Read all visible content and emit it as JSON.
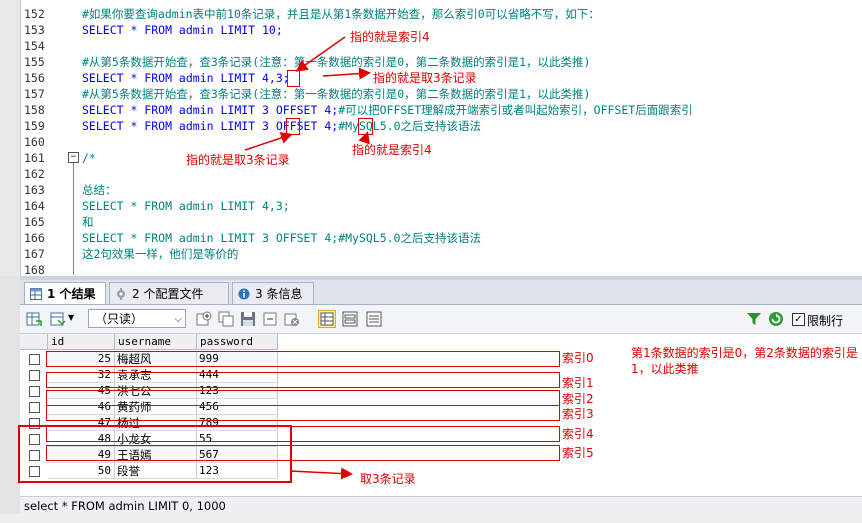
{
  "editor": {
    "lines": [
      {
        "num": "152",
        "parts": [
          {
            "c": "c-comment",
            "t": "#如果你要查询admin表中前10条记录，并且是从第1条数据开始查，那么索引0可以省略不写，如下："
          }
        ]
      },
      {
        "num": "153",
        "parts": [
          {
            "c": "c-plain",
            "t": "SELECT * FROM admin LIMIT 10;"
          }
        ]
      },
      {
        "num": "154",
        "parts": []
      },
      {
        "num": "155",
        "parts": [
          {
            "c": "c-comment",
            "t": "#从第5条数据开始查，查3条记录(注意：第一条数据的索引是0，第二条数据的索引是1，以此类推)"
          }
        ]
      },
      {
        "num": "156",
        "parts": [
          {
            "c": "c-plain",
            "t": "SELECT * FROM admin LIMIT 4,3;"
          }
        ]
      },
      {
        "num": "157",
        "parts": [
          {
            "c": "c-comment",
            "t": "#从第5条数据开始查，查3条记录(注意：第一条数据的索引是0，第二条数据的索引是1，以此类推)"
          }
        ]
      },
      {
        "num": "158",
        "parts": [
          {
            "c": "c-plain",
            "t": "SELECT * FROM admin LIMIT 3 OFFSET 4;"
          },
          {
            "c": "c-comment",
            "t": "#可以把OFFSET理解成开端索引或者叫起始索引，OFFSET后面跟索引"
          }
        ]
      },
      {
        "num": "159",
        "parts": [
          {
            "c": "c-plain",
            "t": "SELECT * FROM admin LIMIT 3 OFFSET 4;"
          },
          {
            "c": "c-comment",
            "t": "#MySQL5.0之后支持该语法"
          }
        ]
      },
      {
        "num": "160",
        "parts": []
      },
      {
        "num": "161",
        "parts": [
          {
            "c": "c-comment",
            "t": "/*"
          }
        ]
      },
      {
        "num": "162",
        "parts": []
      },
      {
        "num": "163",
        "parts": [
          {
            "c": "c-comment",
            "t": "总结："
          }
        ]
      },
      {
        "num": "164",
        "parts": [
          {
            "c": "c-comment",
            "t": "SELECT * FROM admin LIMIT 4,3;"
          }
        ]
      },
      {
        "num": "165",
        "parts": [
          {
            "c": "c-comment",
            "t": "和"
          }
        ]
      },
      {
        "num": "166",
        "parts": [
          {
            "c": "c-comment",
            "t": "SELECT * FROM admin LIMIT 3 OFFSET 4;#MySQL5.0之后支持该语法"
          }
        ]
      },
      {
        "num": "167",
        "parts": [
          {
            "c": "c-comment",
            "t": "这2句效果一样，他们是等价的"
          }
        ]
      },
      {
        "num": "168",
        "parts": []
      }
    ]
  },
  "annotations": {
    "index4_top": "指的就是索引4",
    "take3_mid": "指的就是取3条记录",
    "take3_left": "指的就是取3条记录",
    "index4_right": "指的就是索引4",
    "index_labels": [
      "索引0",
      "索引1",
      "索引2",
      "索引3",
      "索引4",
      "索引5"
    ],
    "explain": "第1条数据的索引是0，第2条数据的索引是1，以此类推",
    "take3_grid": "取3条记录"
  },
  "tabs": [
    {
      "label": "1 个结果",
      "icon": "table-icon",
      "active": true
    },
    {
      "label": "2 个配置文件",
      "icon": "profile-icon",
      "active": false
    },
    {
      "label": "3 条信息",
      "icon": "info-icon",
      "active": false
    }
  ],
  "toolbar": {
    "readonly_value": "（只读）",
    "limit_label": "限制行",
    "filter_label": "Fi"
  },
  "grid": {
    "columns": [
      "id",
      "username",
      "password"
    ],
    "rows": [
      {
        "id": "25",
        "username": "梅超风",
        "password": "999"
      },
      {
        "id": "32",
        "username": "袁承志",
        "password": "444"
      },
      {
        "id": "45",
        "username": "洪七公",
        "password": "123"
      },
      {
        "id": "46",
        "username": "黄药师",
        "password": "456"
      },
      {
        "id": "47",
        "username": "杨过",
        "password": "789"
      },
      {
        "id": "48",
        "username": "小龙女",
        "password": "55"
      },
      {
        "id": "49",
        "username": "王语嫣",
        "password": "567"
      },
      {
        "id": "50",
        "username": "段誉",
        "password": "123"
      }
    ]
  },
  "status": {
    "query": "select * FROM admin LIMIT 0, 1000"
  }
}
